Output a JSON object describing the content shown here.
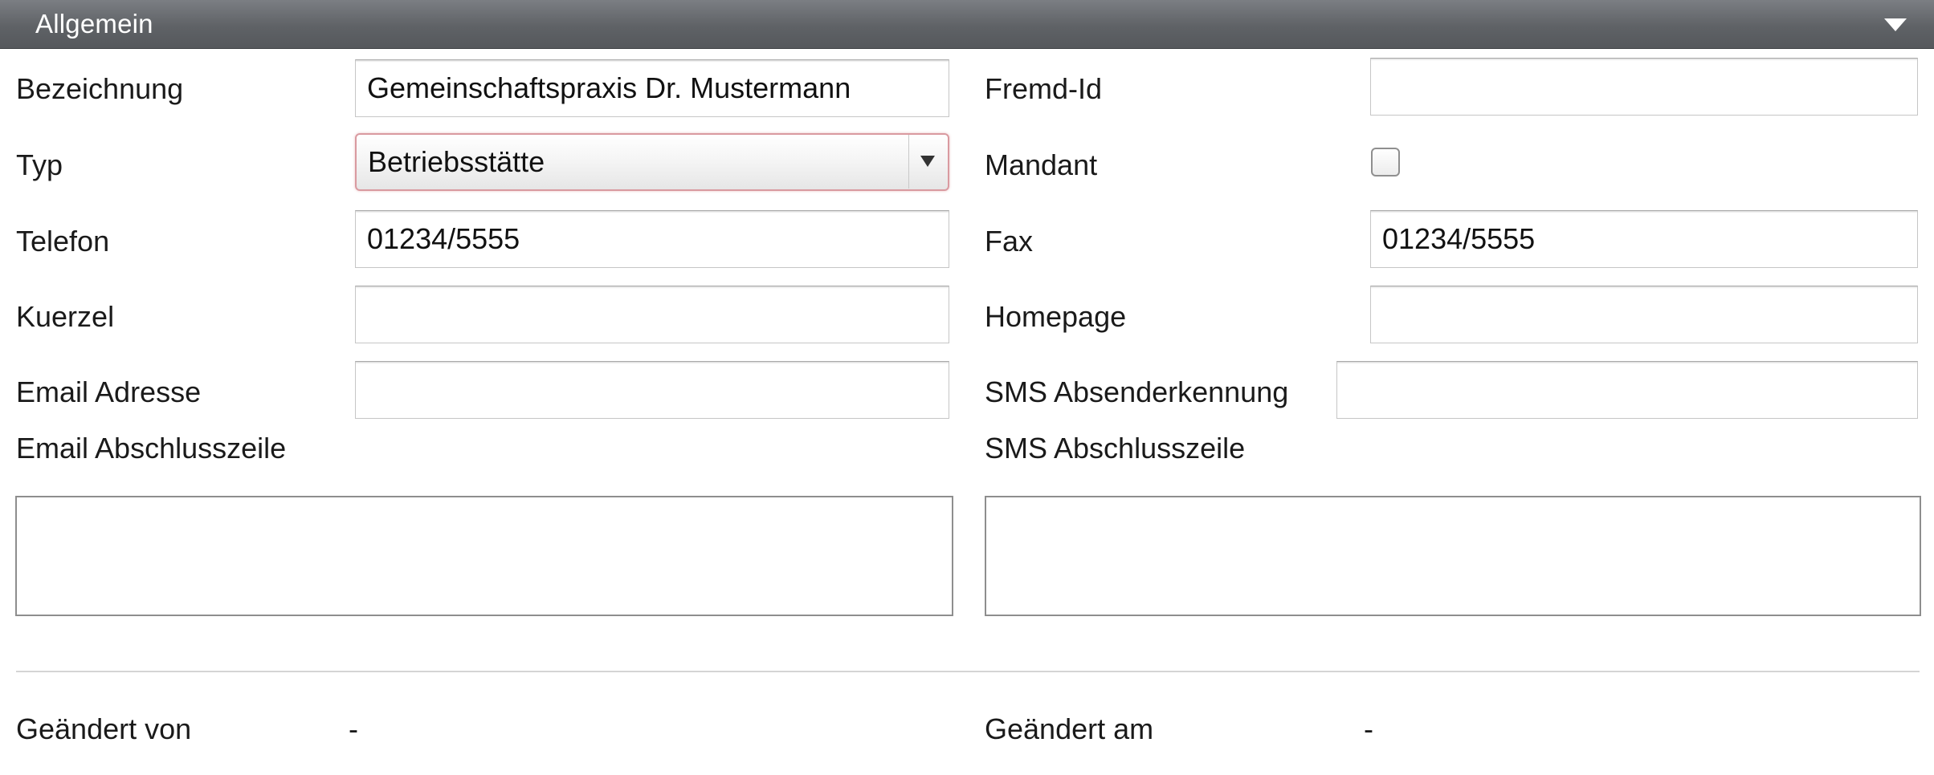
{
  "panel": {
    "title": "Allgemein",
    "collapse_icon": "triangle-down-icon"
  },
  "form": {
    "bezeichnung": {
      "label": "Bezeichnung",
      "value": "Gemeinschaftspraxis Dr. Mustermann"
    },
    "fremd_id": {
      "label": "Fremd-Id",
      "value": ""
    },
    "typ": {
      "label": "Typ",
      "value": "Betriebsstätte"
    },
    "mandant": {
      "label": "Mandant",
      "checked": false
    },
    "telefon": {
      "label": "Telefon",
      "value": "01234/5555"
    },
    "fax": {
      "label": "Fax",
      "value": "01234/5555"
    },
    "kuerzel": {
      "label": "Kuerzel",
      "value": ""
    },
    "homepage": {
      "label": "Homepage",
      "value": ""
    },
    "email_adresse": {
      "label": "Email Adresse",
      "value": ""
    },
    "sms_absenderkennung": {
      "label": "SMS Absenderkennung",
      "value": ""
    },
    "email_abschlusszeile": {
      "label": "Email Abschlusszeile",
      "value": ""
    },
    "sms_abschlusszeile": {
      "label": "SMS Abschlusszeile",
      "value": ""
    }
  },
  "footer": {
    "geaendert_von": {
      "label": "Geändert von",
      "value": "-"
    },
    "geaendert_am": {
      "label": "Geändert am",
      "value": "-"
    }
  },
  "colors": {
    "header": "#5f6266",
    "focus_border": "#d99aa0"
  }
}
